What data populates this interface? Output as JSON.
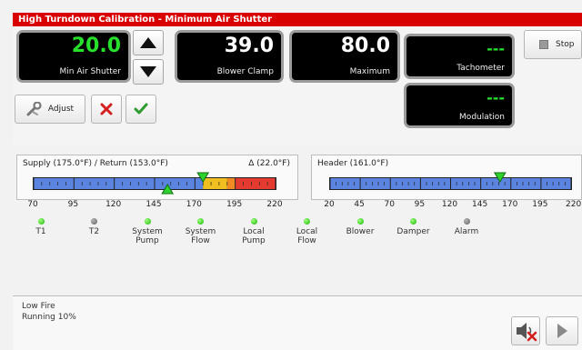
{
  "window": {
    "title": "High Turndown Calibration - Minimum Air Shutter"
  },
  "readouts": {
    "min_air_shutter": {
      "value": "20.0",
      "label": "Min Air Shutter"
    },
    "blower_clamp": {
      "value": "39.0",
      "label": "Blower Clamp"
    },
    "maximum": {
      "value": "80.0",
      "label": "Maximum"
    },
    "tachometer": {
      "value": "---",
      "label": "Tachometer"
    },
    "modulation": {
      "value": "---",
      "label": "Modulation"
    }
  },
  "controls": {
    "stop_label": "Stop",
    "adjust_label": "Adjust",
    "up_icon": "arrow-up-icon",
    "down_icon": "arrow-down-icon",
    "cancel_icon": "x-icon",
    "confirm_icon": "check-icon"
  },
  "supply_gauge": {
    "title": "Supply (175.0°F) / Return (153.0°F)",
    "delta": "Δ (22.0°F)",
    "scale": [
      "70",
      "95",
      "120",
      "145",
      "170",
      "195",
      "220"
    ],
    "min": 70,
    "max": 220,
    "supply_value": 175.0,
    "return_value": 153.0,
    "zones": [
      {
        "from": 70,
        "to": 175,
        "color": "#5a84e0"
      },
      {
        "from": 175,
        "to": 190,
        "color": "#f0c020"
      },
      {
        "from": 190,
        "to": 195,
        "color": "#f08a24"
      },
      {
        "from": 195,
        "to": 220,
        "color": "#e53a30"
      }
    ]
  },
  "header_gauge": {
    "title": "Header (161.0°F)",
    "scale": [
      "20",
      "45",
      "70",
      "95",
      "120",
      "145",
      "170",
      "195",
      "220"
    ],
    "min": 20,
    "max": 220,
    "value": 161.0
  },
  "indicators": [
    {
      "label": "T1",
      "state": "green"
    },
    {
      "label": "T2",
      "state": "gray"
    },
    {
      "label": "System\nPump",
      "state": "green"
    },
    {
      "label": "System\nFlow",
      "state": "green"
    },
    {
      "label": "Local\nPump",
      "state": "green"
    },
    {
      "label": "Local\nFlow",
      "state": "green"
    },
    {
      "label": "Blower",
      "state": "green"
    },
    {
      "label": "Damper",
      "state": "green"
    },
    {
      "label": "Alarm",
      "state": "gray"
    }
  ],
  "status": {
    "line1": "Low Fire",
    "line2": "Running 10%"
  },
  "footer_icons": {
    "mute": "speaker-muted-icon",
    "play": "play-icon"
  }
}
